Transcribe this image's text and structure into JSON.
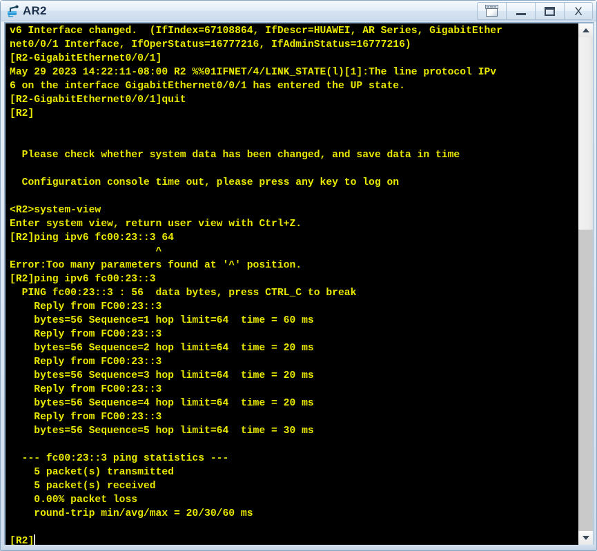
{
  "window": {
    "title": "AR2",
    "app_icon": "router-device-icon",
    "buttons": [
      {
        "name": "window-list-button",
        "icon": "restore-stack-icon",
        "label": ""
      },
      {
        "name": "minimize-button",
        "icon": "minimize-icon",
        "label": ""
      },
      {
        "name": "maximize-button",
        "icon": "maximize-icon",
        "label": ""
      },
      {
        "name": "close-button",
        "icon": "close-icon",
        "label": "X"
      }
    ]
  },
  "terminal": {
    "background_color": "#000000",
    "text_color": "#e8e800",
    "cursor": "block-cursor",
    "content": "v6 Interface changed.  (IfIndex=67108864, IfDescr=HUAWEI, AR Series, GigabitEther\nnet0/0/1 Interface, IfOperStatus=16777216, IfAdminStatus=16777216)\n[R2-GigabitEthernet0/0/1]\nMay 29 2023 14:22:11-08:00 R2 %%01IFNET/4/LINK_STATE(l)[1]:The line protocol IPv\n6 on the interface GigabitEthernet0/0/1 has entered the UP state.\n[R2-GigabitEthernet0/0/1]quit\n[R2]\n\n\n  Please check whether system data has been changed, and save data in time\n\n  Configuration console time out, please press any key to log on\n\n<R2>system-view\nEnter system view, return user view with Ctrl+Z.\n[R2]ping ipv6 fc00:23::3 64\n                        ^\nError:Too many parameters found at '^' position.\n[R2]ping ipv6 fc00:23::3\n  PING fc00:23::3 : 56  data bytes, press CTRL_C to break\n    Reply from FC00:23::3\n    bytes=56 Sequence=1 hop limit=64  time = 60 ms\n    Reply from FC00:23::3\n    bytes=56 Sequence=2 hop limit=64  time = 20 ms\n    Reply from FC00:23::3\n    bytes=56 Sequence=3 hop limit=64  time = 20 ms\n    Reply from FC00:23::3\n    bytes=56 Sequence=4 hop limit=64  time = 20 ms\n    Reply from FC00:23::3\n    bytes=56 Sequence=5 hop limit=64  time = 30 ms\n\n  --- fc00:23::3 ping statistics ---\n    5 packet(s) transmitted\n    5 packet(s) received\n    0.00% packet loss\n    round-trip min/avg/max = 20/30/60 ms\n\n[R2]"
  },
  "scrollbar": {
    "up_arrow": "chevron-up-icon",
    "down_arrow": "chevron-down-icon",
    "thumb_position_percent": 0,
    "thumb_size_percent": 39
  }
}
